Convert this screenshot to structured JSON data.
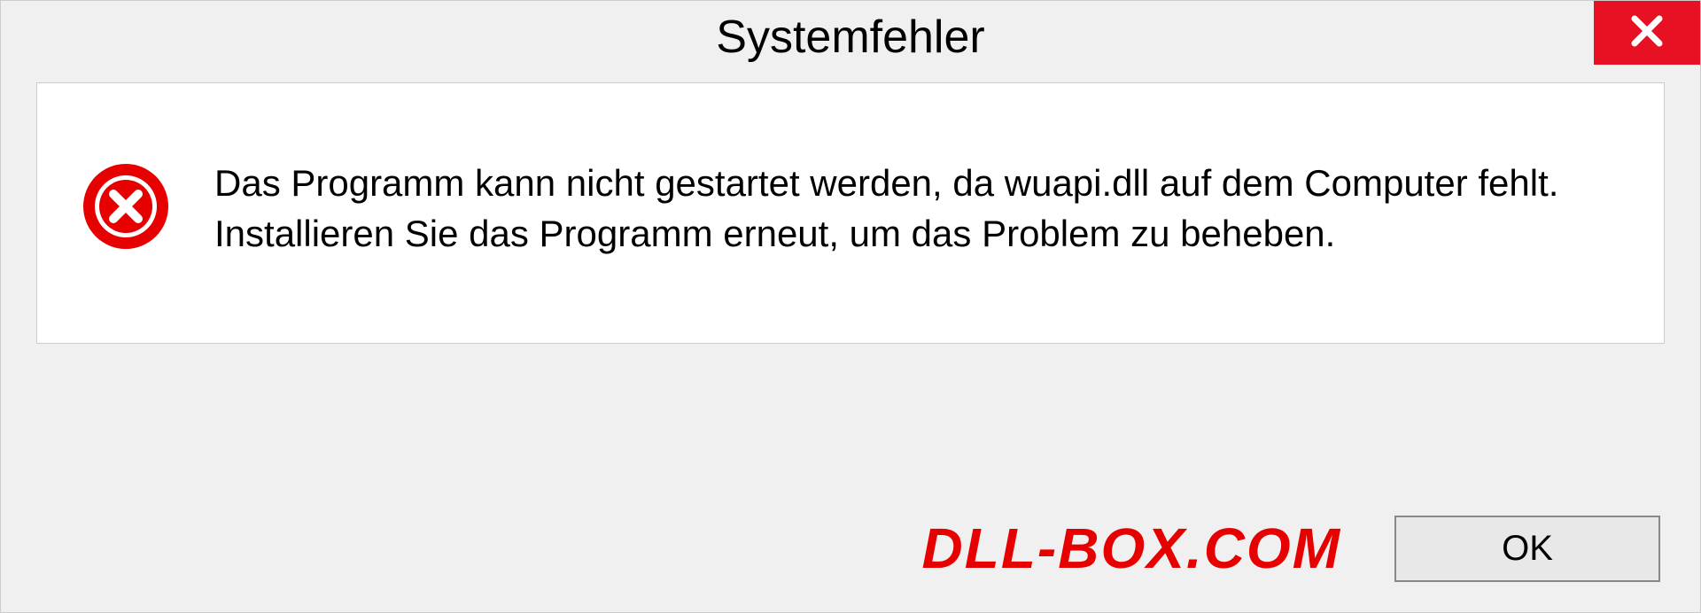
{
  "dialog": {
    "title": "Systemfehler",
    "message": "Das Programm kann nicht gestartet werden, da wuapi.dll auf dem Computer fehlt. Installieren Sie das Programm erneut, um das Problem zu beheben.",
    "ok_label": "OK",
    "watermark": "DLL-BOX.COM"
  }
}
